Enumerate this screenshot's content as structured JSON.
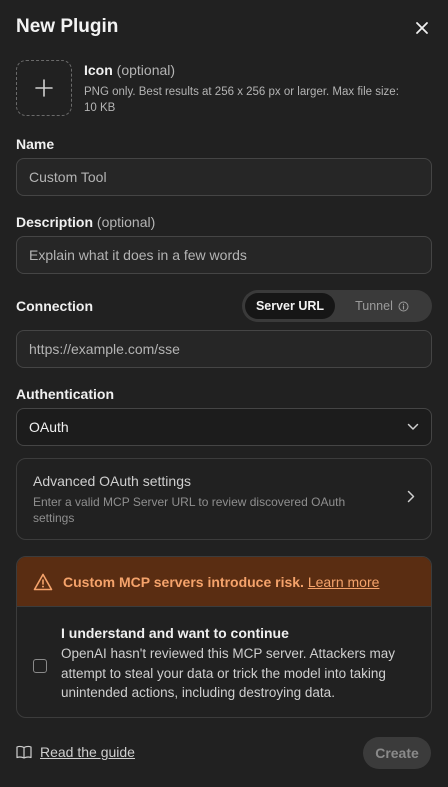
{
  "dialog": {
    "title": "New Plugin"
  },
  "icon_field": {
    "label": "Icon",
    "optional": "(optional)",
    "description": "PNG only. Best results at 256 x 256 px or larger. Max file size: 10 KB"
  },
  "name_field": {
    "label": "Name",
    "placeholder": "Custom Tool"
  },
  "description_field": {
    "label": "Description",
    "optional": "(optional)",
    "placeholder": "Explain what it does in a few words"
  },
  "connection": {
    "label": "Connection",
    "options": [
      "Server URL",
      "Tunnel"
    ],
    "selected": "Server URL",
    "placeholder": "https://example.com/sse"
  },
  "authentication": {
    "label": "Authentication",
    "selected": "OAuth"
  },
  "advanced": {
    "title": "Advanced OAuth settings",
    "description": "Enter a valid MCP Server URL to review discovered OAuth settings"
  },
  "warning": {
    "message": "Custom MCP servers introduce risk.",
    "link": "Learn more",
    "consent_title": "I understand and want to continue",
    "consent_body": "OpenAI hasn't reviewed this MCP server. Attackers may attempt to steal your data or trick the model into taking unintended actions, including destroying data.",
    "checked": false
  },
  "footer": {
    "guide_link": "Read the guide",
    "create_label": "Create"
  },
  "colors": {
    "background": "#212121",
    "warning_bg": "#5a2d12",
    "warning_text": "#f5a36b"
  },
  "icons": [
    "close-icon",
    "plus-icon",
    "info-icon",
    "chevron-down-icon",
    "chevron-right-icon",
    "warning-icon",
    "book-icon"
  ]
}
